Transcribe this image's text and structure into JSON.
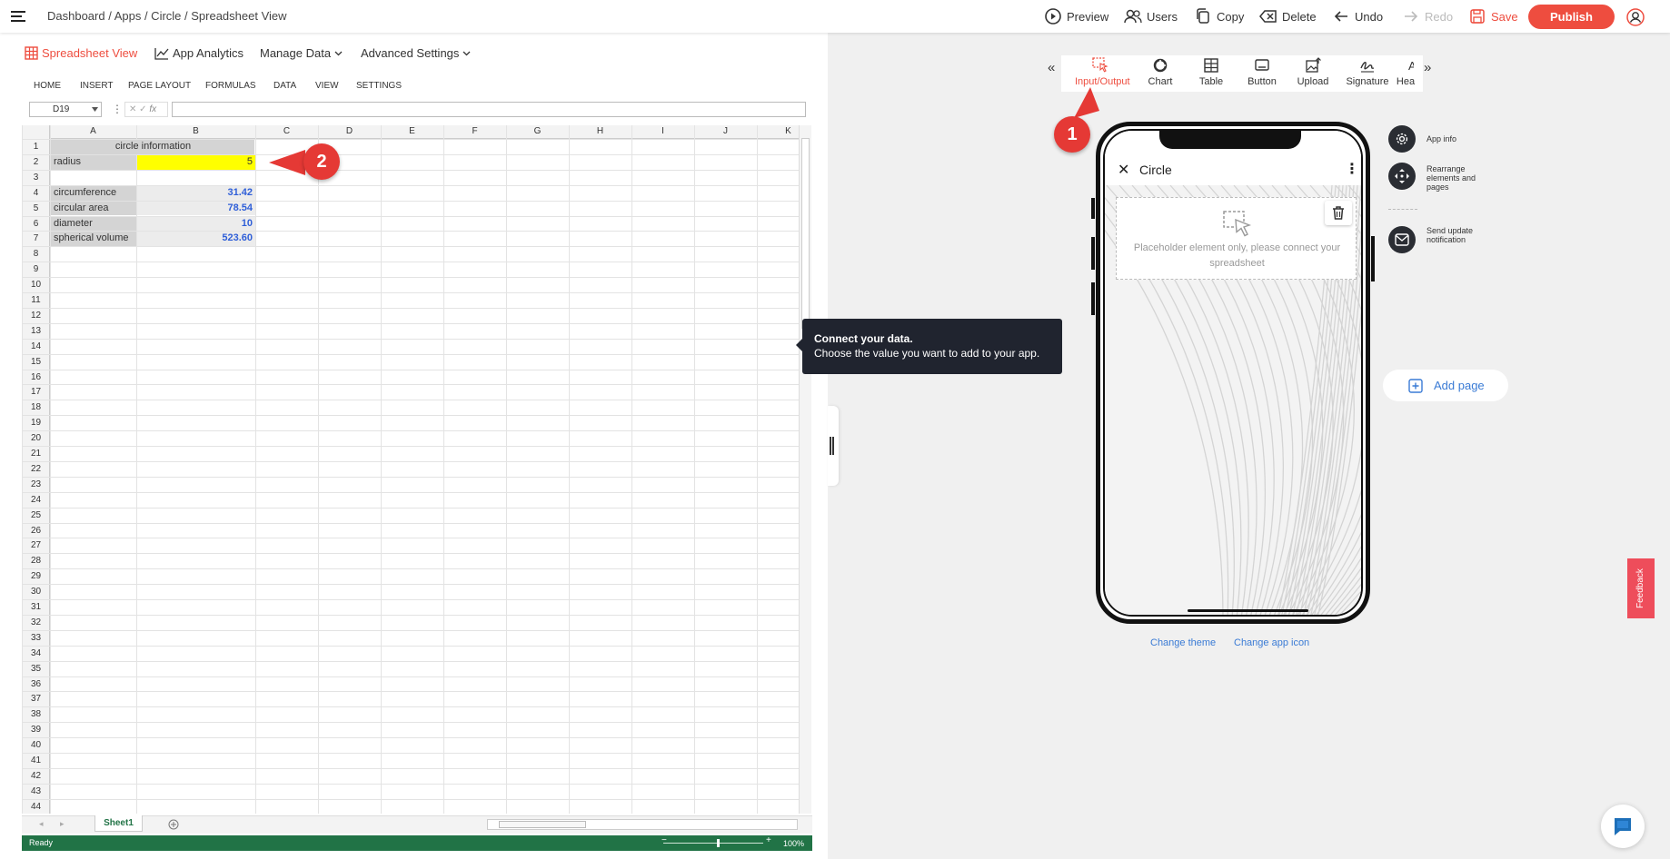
{
  "topbar": {
    "breadcrumb": "Dashboard / Apps / Circle / Spreadsheet View",
    "preview": "Preview",
    "users": "Users",
    "copy": "Copy",
    "delete": "Delete",
    "undo": "Undo",
    "redo": "Redo",
    "save": "Save",
    "publish": "Publish"
  },
  "view_tabs": {
    "spreadsheet": "Spreadsheet View",
    "analytics": "App Analytics",
    "manage": "Manage Data",
    "advanced": "Advanced Settings"
  },
  "ribbon": [
    "HOME",
    "INSERT",
    "PAGE LAYOUT",
    "FORMULAS",
    "DATA",
    "VIEW",
    "SETTINGS"
  ],
  "formula": {
    "cell_ref": "D19",
    "fx": "fx",
    "value": ""
  },
  "columns": [
    "A",
    "B",
    "C",
    "D",
    "E",
    "F",
    "G",
    "H",
    "I",
    "J",
    "K"
  ],
  "rows": [
    "1",
    "2",
    "3",
    "4",
    "5",
    "6",
    "7",
    "8",
    "9",
    "10",
    "11",
    "12",
    "13",
    "14",
    "15",
    "16",
    "17",
    "18",
    "19",
    "20",
    "21",
    "22",
    "23",
    "24",
    "25",
    "26",
    "27",
    "28",
    "29",
    "30",
    "31",
    "32",
    "33",
    "34",
    "35",
    "36",
    "37",
    "38",
    "39",
    "40",
    "41",
    "42",
    "43",
    "44"
  ],
  "cells": {
    "a1": "circle information",
    "a2": "radius",
    "b2": "5",
    "a4": "circumference",
    "b4": "31.42",
    "a5": "circular area",
    "b5": "78.54",
    "a6": "diameter",
    "b6": "10",
    "a7": "spherical volume",
    "b7": "523.60"
  },
  "sheet": {
    "tab": "Sheet1",
    "status": "Ready",
    "zoom": "100%"
  },
  "tooltip": {
    "title": "Connect your data.",
    "body": "Choose the value you want to add to your app."
  },
  "widgets": [
    "Input/Output",
    "Chart",
    "Table",
    "Button",
    "Upload",
    "Signature",
    "Hea"
  ],
  "phone": {
    "title": "Circle",
    "placeholder": "Placeholder element only, please connect your spreadsheet"
  },
  "side": {
    "app_info": "App info",
    "rearrange": "Rearrange elements and pages",
    "send": "Send update notification",
    "add_page": "Add page"
  },
  "links": {
    "theme": "Change theme",
    "icon": "Change app icon"
  },
  "feedback": "Feedback",
  "badges": [
    "1",
    "2"
  ],
  "colors": {
    "accent": "#ee4d3f",
    "yellow": "#ffff00",
    "value_blue": "#2f5fd8",
    "status_green": "#217346"
  }
}
